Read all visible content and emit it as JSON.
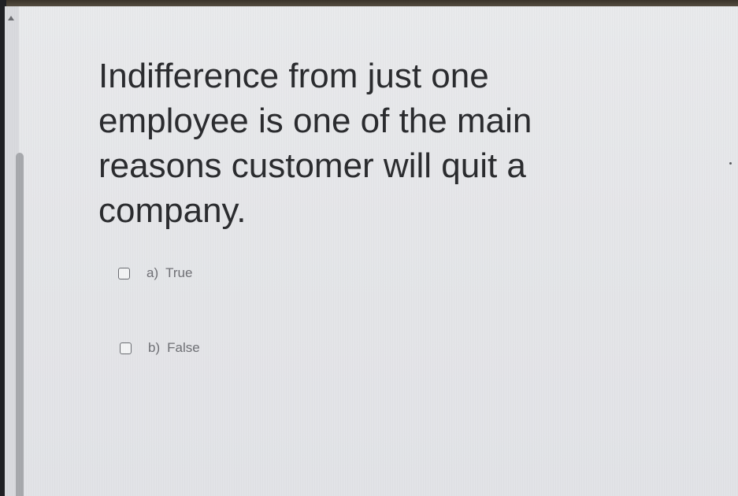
{
  "question": {
    "text": "Indifference from just one employee is one of the main reasons customer will quit a company."
  },
  "options": [
    {
      "letter": "a)",
      "label": "True",
      "checked": false
    },
    {
      "letter": "b)",
      "label": "False",
      "checked": false
    }
  ],
  "colors": {
    "background": "#e7e8ea",
    "question_text": "#2b2c2f",
    "option_text": "#6f7075",
    "scrollbar_thumb": "#a7a9ad"
  }
}
